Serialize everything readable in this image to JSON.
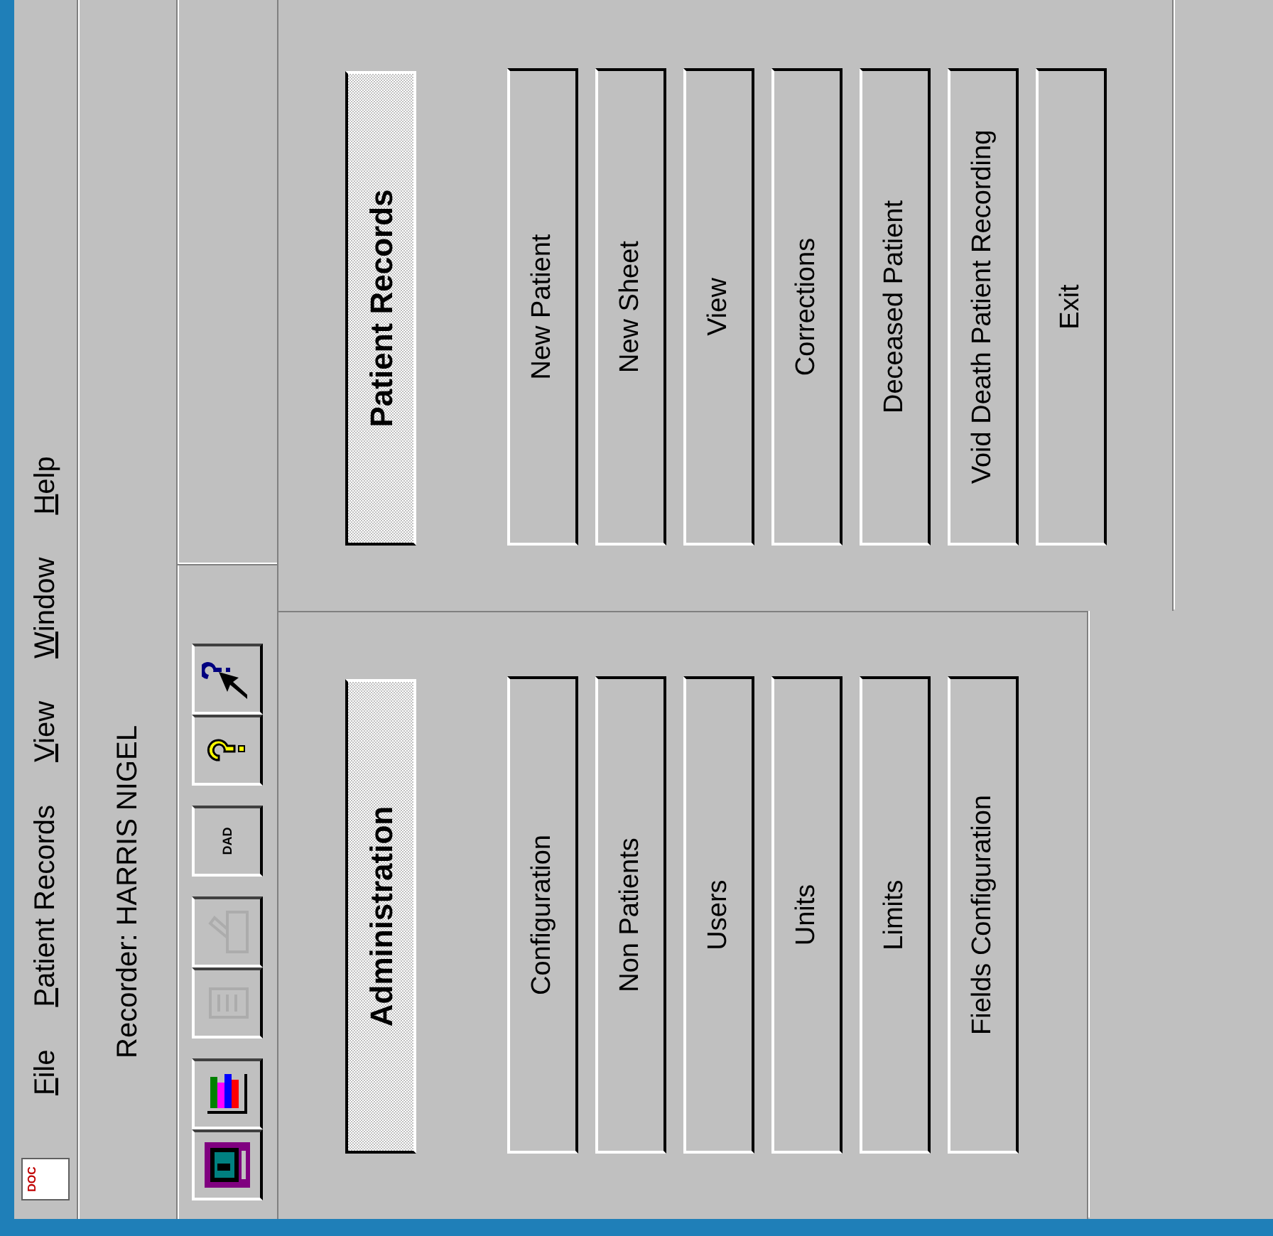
{
  "menu_bar": {
    "app_icon": {
      "label": "DOC"
    },
    "items": [
      {
        "label": "File",
        "mnemonic": true
      },
      {
        "label": "Patient Records",
        "mnemonic": true
      },
      {
        "label": "View",
        "mnemonic": true
      },
      {
        "label": "Window",
        "mnemonic": true
      },
      {
        "label": "Help",
        "mnemonic": true
      }
    ]
  },
  "recorder": "Recorder: HARRIS NIGEL",
  "toolbar": [
    {
      "kind": "monitor",
      "disabled": false
    },
    {
      "kind": "chart",
      "disabled": false
    },
    {
      "kind": "cabinet",
      "disabled": true
    },
    {
      "kind": "tray",
      "disabled": true
    },
    {
      "kind": "text",
      "label": "DAD",
      "disabled": false
    },
    {
      "kind": "help",
      "disabled": false
    },
    {
      "kind": "whats-this",
      "disabled": false
    }
  ],
  "panels": [
    {
      "title": "Administration",
      "buttons": [
        "Configuration",
        "Non Patients",
        "Users",
        "Units",
        "Limits",
        "Fields Configuration"
      ]
    },
    {
      "title": "Patient Records",
      "buttons": [
        "New Patient",
        "New Sheet",
        "View",
        "Corrections",
        "Deceased Patient",
        "Void Death Patient Recording",
        "Exit"
      ]
    }
  ]
}
